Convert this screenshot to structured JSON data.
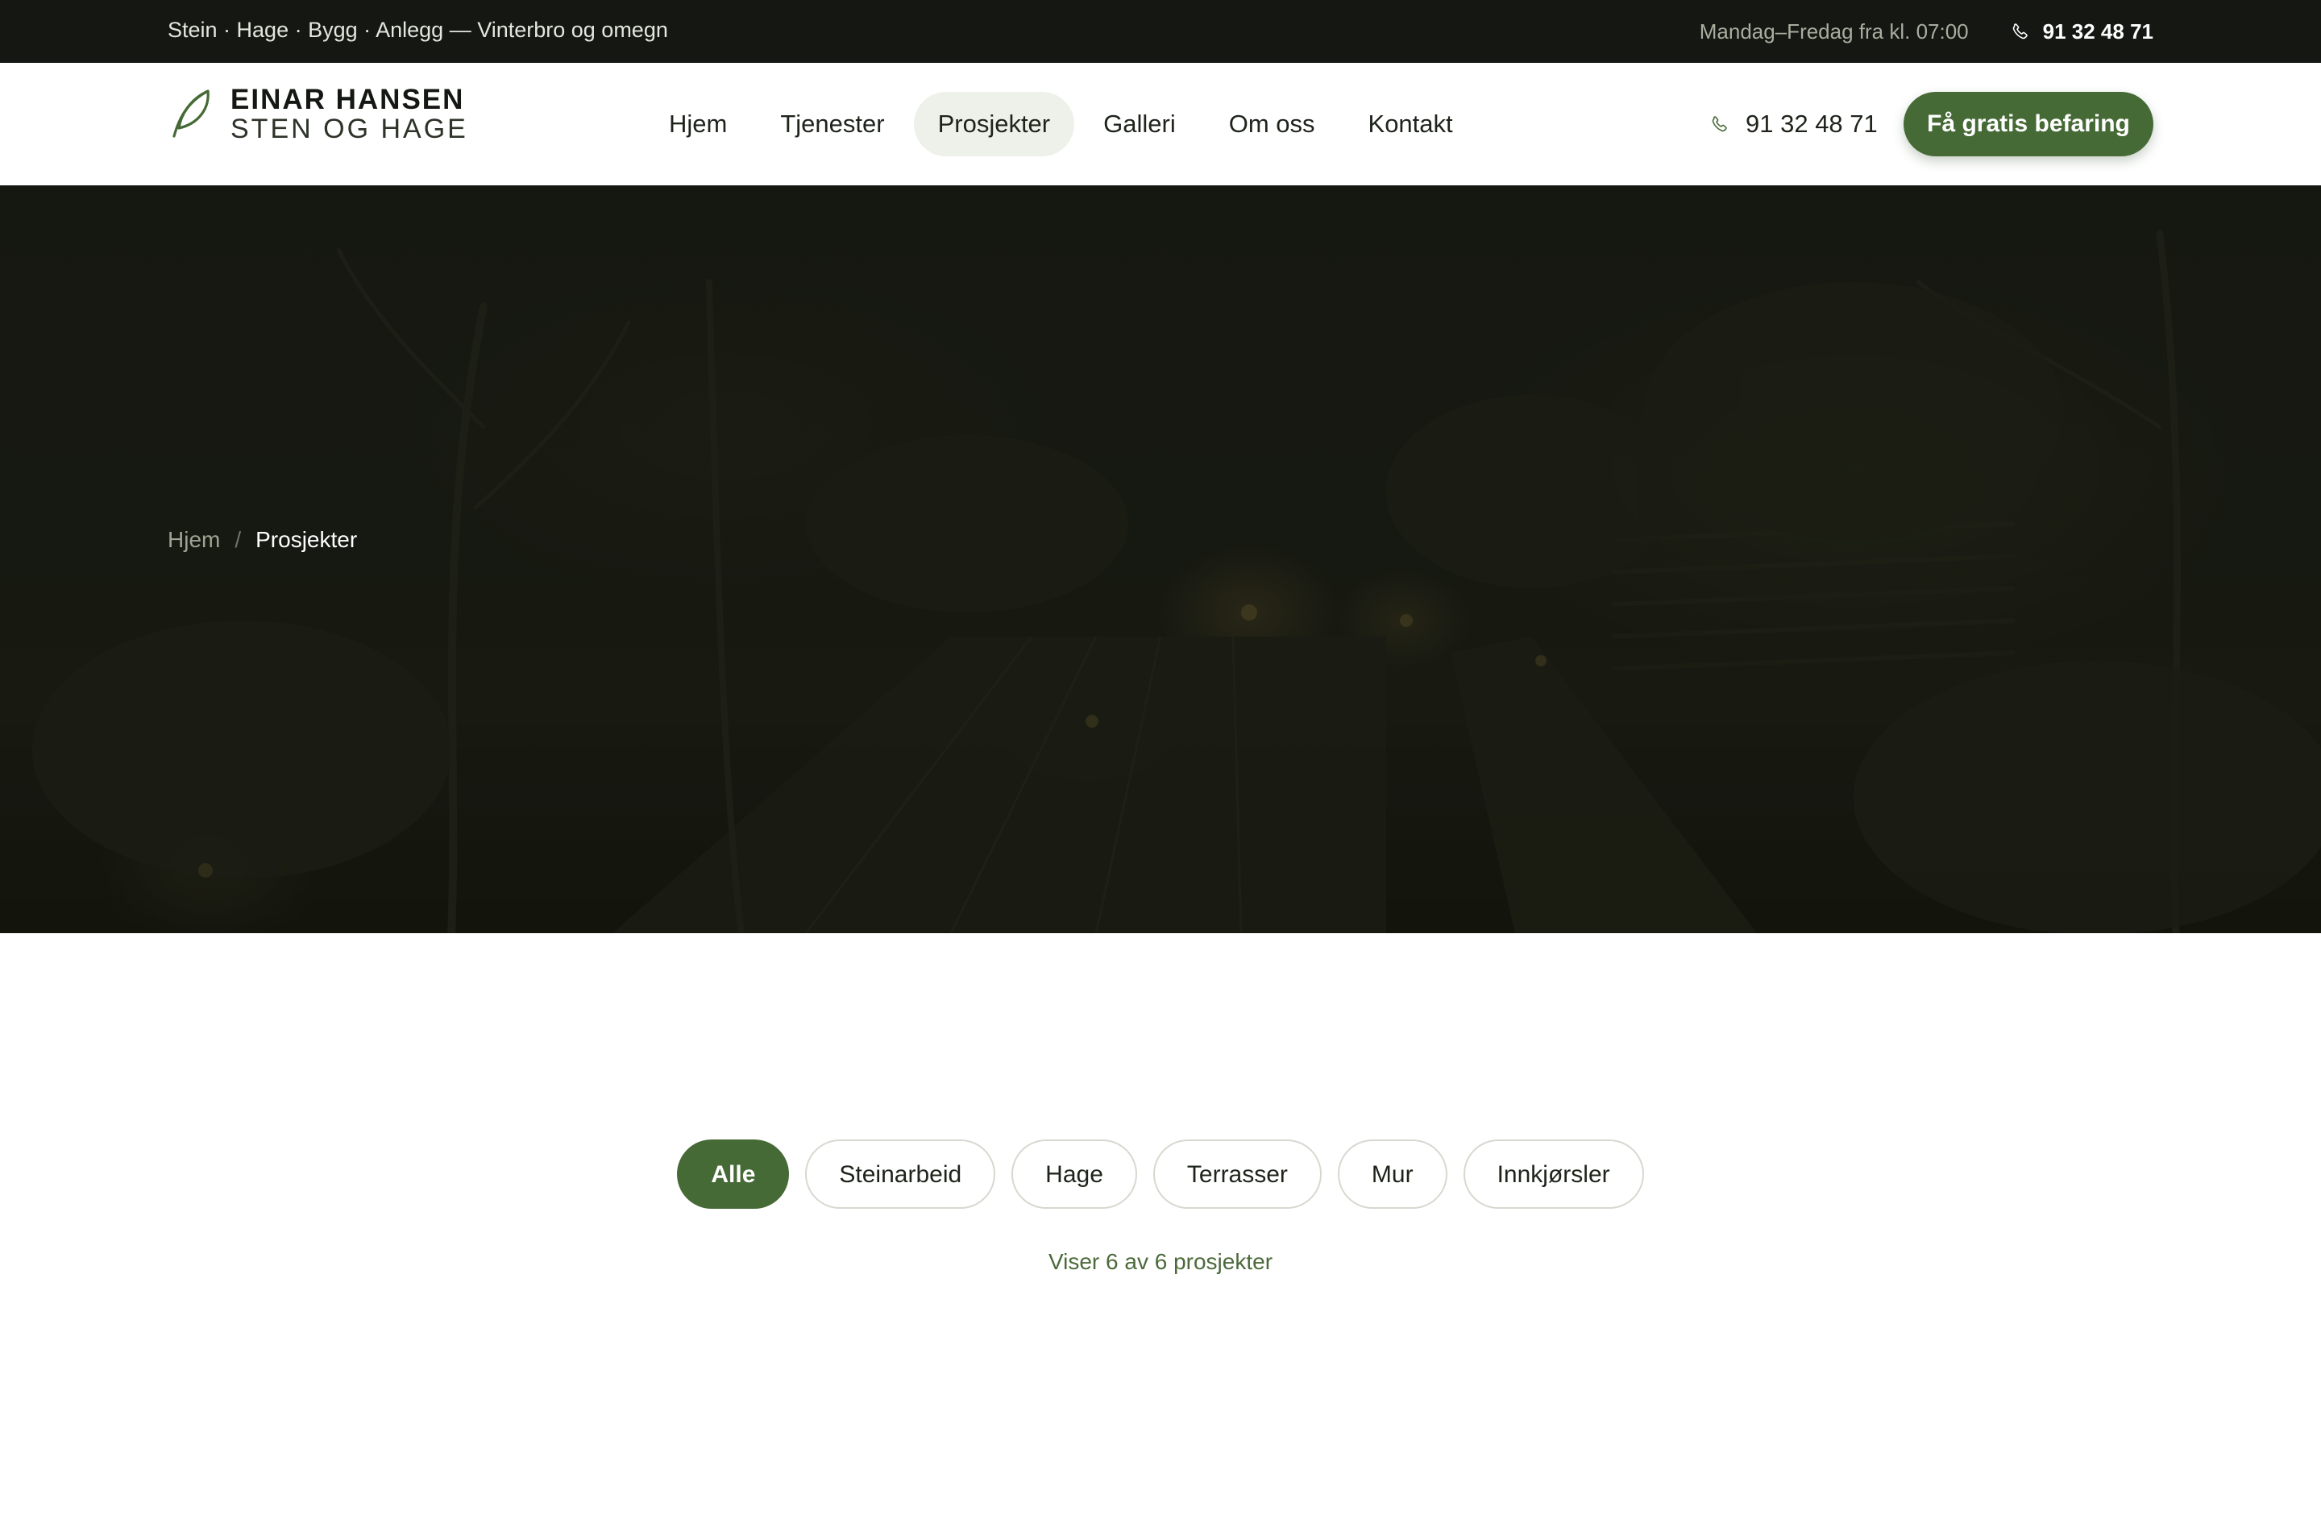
{
  "topbar": {
    "tagline": "Stein · Hage · Bygg · Anlegg — Vinterbro og omegn",
    "hours": "Mandag–Fredag fra kl. 07:00",
    "phone": "91 32 48 71",
    "phone_icon": "phone-icon"
  },
  "header": {
    "logo_icon": "leaf-icon",
    "logo_line1": "EINAR HANSEN",
    "logo_line2": "STEN OG HAGE",
    "nav": [
      {
        "label": "Hjem",
        "active": false
      },
      {
        "label": "Tjenester",
        "active": false
      },
      {
        "label": "Prosjekter",
        "active": true
      },
      {
        "label": "Galleri",
        "active": false
      },
      {
        "label": "Om oss",
        "active": false
      },
      {
        "label": "Kontakt",
        "active": false
      }
    ],
    "phone": "91 32 48 71",
    "cta_label": "Få gratis befaring"
  },
  "hero": {
    "breadcrumb": {
      "home": "Hjem",
      "separator": "/",
      "current": "Prosjekter"
    }
  },
  "filters": {
    "chips": [
      {
        "label": "Alle",
        "active": true
      },
      {
        "label": "Steinarbeid",
        "active": false
      },
      {
        "label": "Hage",
        "active": false
      },
      {
        "label": "Terrasser",
        "active": false
      },
      {
        "label": "Mur",
        "active": false
      },
      {
        "label": "Innkjørsler",
        "active": false
      }
    ],
    "count_text": "Viser 6 av 6 prosjekter"
  },
  "colors": {
    "brand_green": "#466a36",
    "topbar_bg": "#141712",
    "active_nav_bg": "#eef1ea"
  }
}
